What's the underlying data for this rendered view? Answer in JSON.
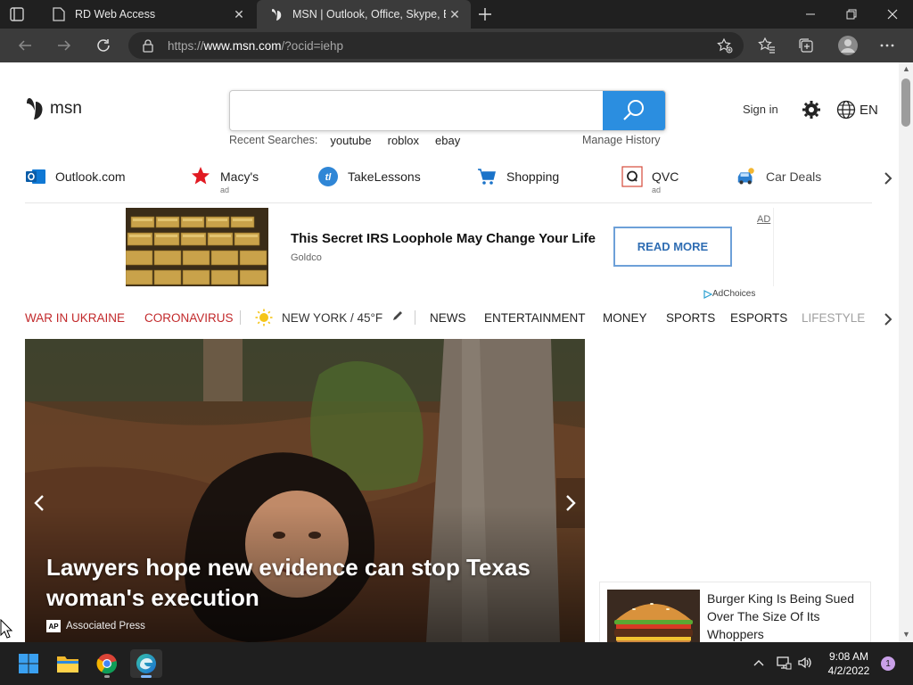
{
  "browser": {
    "tabs": [
      {
        "title": "RD Web Access",
        "active": false
      },
      {
        "title": "MSN | Outlook, Office, Skype, Bing",
        "active": true
      }
    ],
    "url_prefix": "https://",
    "url_host": "www.msn.com",
    "url_path": "/?ocid=iehp"
  },
  "header": {
    "logo_text": "msn",
    "search_placeholder": "",
    "recent_label": "Recent Searches:",
    "recent_items": [
      "youtube",
      "roblox",
      "ebay"
    ],
    "manage_history": "Manage History",
    "sign_in": "Sign in",
    "language": "EN"
  },
  "quicklinks": [
    {
      "label": "Outlook.com",
      "ad": ""
    },
    {
      "label": "Macy's",
      "ad": "ad"
    },
    {
      "label": "TakeLessons",
      "ad": ""
    },
    {
      "label": "Shopping",
      "ad": ""
    },
    {
      "label": "QVC",
      "ad": "ad"
    },
    {
      "label": "Car Deals",
      "ad": ""
    }
  ],
  "ad": {
    "headline": "This Secret IRS Loophole May Change Your Life",
    "source": "Goldco",
    "cta": "READ MORE",
    "tag": "AD",
    "adchoices": "AdChoices"
  },
  "nav": {
    "items": [
      "WAR IN UKRAINE",
      "CORONAVIRUS",
      "NEW YORK / 45°F",
      "NEWS",
      "ENTERTAINMENT",
      "MONEY",
      "SPORTS",
      "ESPORTS",
      "LIFESTYLE"
    ]
  },
  "hero": {
    "title": "Lawyers hope new evidence can stop Texas woman's execution",
    "source_badge": "AP",
    "source": "Associated Press"
  },
  "card": {
    "title": "Burger King Is Being Sued Over The Size Of Its Whoppers"
  },
  "taskbar": {
    "time": "9:08 AM",
    "date": "4/2/2022",
    "notifications": "1"
  },
  "colors": {
    "accent_blue": "#2b8ee0",
    "nav_red": "#c2292b",
    "chrome_dark": "#202020"
  }
}
